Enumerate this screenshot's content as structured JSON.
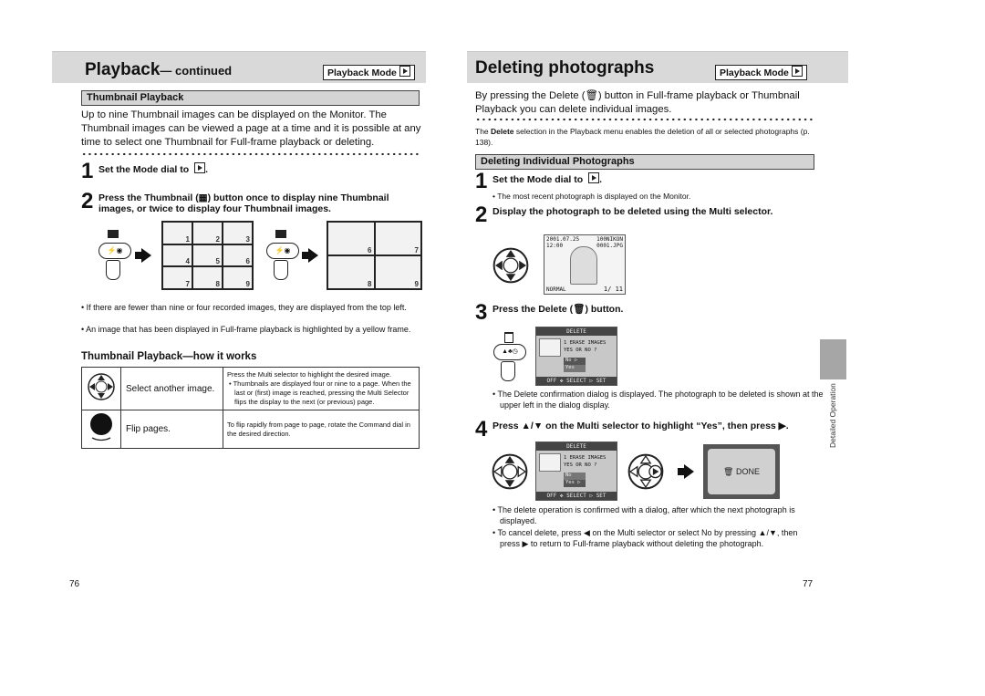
{
  "left_page": {
    "title_main": "Playback",
    "title_suffix": "— continued",
    "mode_label": "Playback Mode",
    "section_head": "Thumbnail Playback",
    "intro": "Up to nine Thumbnail images can be displayed on the Monitor. The Thumbnail images can be viewed a page at a time and it is possible at any time to select one Thumbnail for Full-frame playback or deleting.",
    "steps": [
      {
        "num": "1",
        "text": "Set the Mode dial to"
      },
      {
        "num": "2",
        "text": "Press the Thumbnail (▦) button once to display nine Thumbnail images, or twice to display four Thumbnail images."
      }
    ],
    "button_label": "⚡◉",
    "nine_labels": [
      "1",
      "2",
      "3",
      "4",
      "5",
      "6",
      "7",
      "8",
      "9"
    ],
    "four_labels": [
      "6",
      "7",
      "8",
      "9"
    ],
    "bullets": [
      "If there are fewer than nine or four recorded images, they are displayed from the top left.",
      "An image that has been displayed in Full-frame playback is highlighted by a yellow frame."
    ],
    "how_title": "Thumbnail Playback—how it works",
    "how_rows": [
      {
        "icon": "multi-selector-icon",
        "action": "Select another image.",
        "desc": "Press the Multi selector to highlight the desired image.",
        "bullet": "Thumbnails are displayed four or nine to a page. When the last or (first) image is reached, pressing the Multi Selector flips the display to the next (or previous) page."
      },
      {
        "icon": "command-dial-icon",
        "action": "Flip pages.",
        "desc": "To flip rapidly from page to page, rotate the Command dial in the desired direction.",
        "bullet": ""
      }
    ],
    "page_number": "76"
  },
  "right_page": {
    "title": "Deleting photographs",
    "mode_label": "Playback Mode",
    "intro": "By pressing the Delete (🗑) button in Full-frame playback or Thumbnail Playback you can delete individual images.",
    "note_pre": "The ",
    "note_bold": "Delete",
    "note_post": " selection in the Playback menu enables the deletion of all or selected photographs (p. 138).",
    "section_head": "Deleting Individual Photographs",
    "steps": [
      {
        "num": "1",
        "text": "Set the Mode dial to"
      },
      {
        "num": "2",
        "text": "Display the photograph to be deleted using the Multi selector."
      },
      {
        "num": "3",
        "text": "Press the Delete (🗑) button."
      },
      {
        "num": "4",
        "text": "Press ▲/▼ on the Multi selector to highlight “Yes”, then press ▶."
      }
    ],
    "step1_bullet": "The most recent photograph is displayed on the Monitor.",
    "lcd_photo": {
      "date": "2001.07.25",
      "time": "12:00",
      "folder": "100NIKON",
      "file": "0001.JPG",
      "quality": "NORMAL",
      "frame": "1/ 11"
    },
    "lcd_dialog": {
      "title": "DELETE",
      "line1": "1 ERASE IMAGES",
      "line2": "YES OR NO ?",
      "opt_no": "No",
      "opt_yes": "Yes",
      "footer_off": "OFF",
      "footer_select": "SELECT",
      "footer_set": "SET"
    },
    "step3_bullet": "The Delete confirmation dialog is displayed. The photograph to be deleted is shown at the upper left in the dialog display.",
    "done_label": "DONE",
    "bullets": [
      "The delete operation is confirmed with a dialog, after which the next photograph is displayed.",
      "To cancel delete, press ◀ on the Multi selector or select No by pressing ▲/▼, then press ▶ to return to Full-frame playback without deleting the photograph."
    ],
    "side_tab": "Detailed Operation",
    "page_number": "77"
  }
}
